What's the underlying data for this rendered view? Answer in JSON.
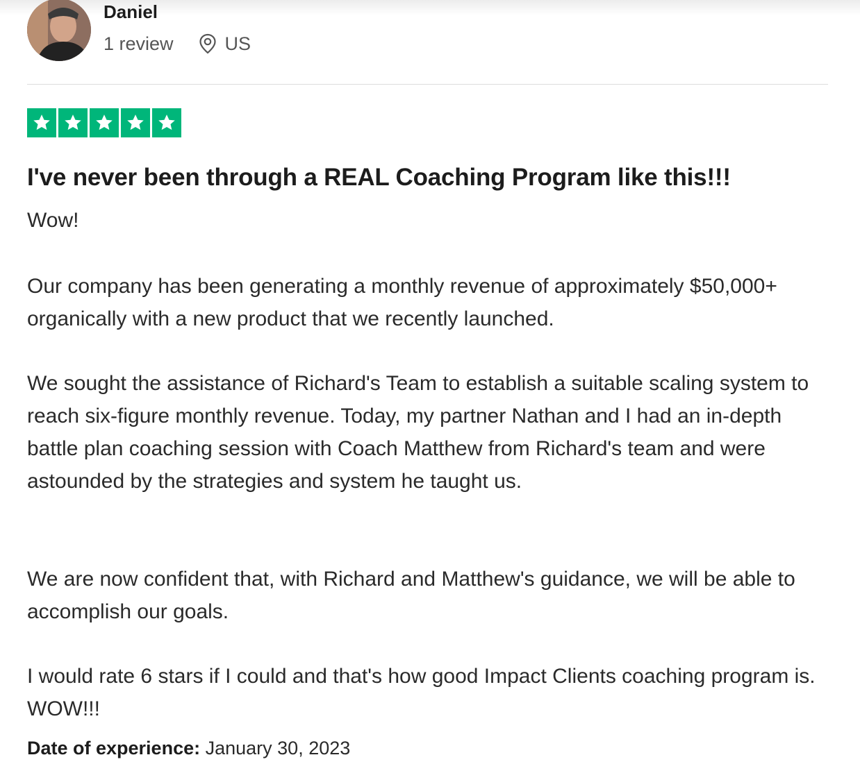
{
  "reviewer": {
    "name": "Daniel",
    "review_count": "1 review",
    "country": "US"
  },
  "rating": {
    "stars": 5,
    "max": 5,
    "color": "#00b67a"
  },
  "review": {
    "title": "I've never been through a REAL Coaching Program like this!!!",
    "paragraphs": [
      "Wow!",
      "Our company has been generating a monthly revenue of approximately $50,000+ organically with a new product that we recently launched.",
      "We sought the assistance of Richard's Team to establish a suitable scaling system to reach six-figure monthly revenue. Today, my partner Nathan and I had an in-depth battle plan coaching session with Coach Matthew from Richard's team and were astounded by the strategies and system he taught us.",
      "We are now confident that, with Richard and Matthew's guidance, we will be able to accomplish our goals.",
      "I would rate 6 stars if I could and that's how good Impact Clients coaching program is. WOW!!!"
    ],
    "date_label": "Date of experience:",
    "date_value": "January 30, 2023"
  }
}
